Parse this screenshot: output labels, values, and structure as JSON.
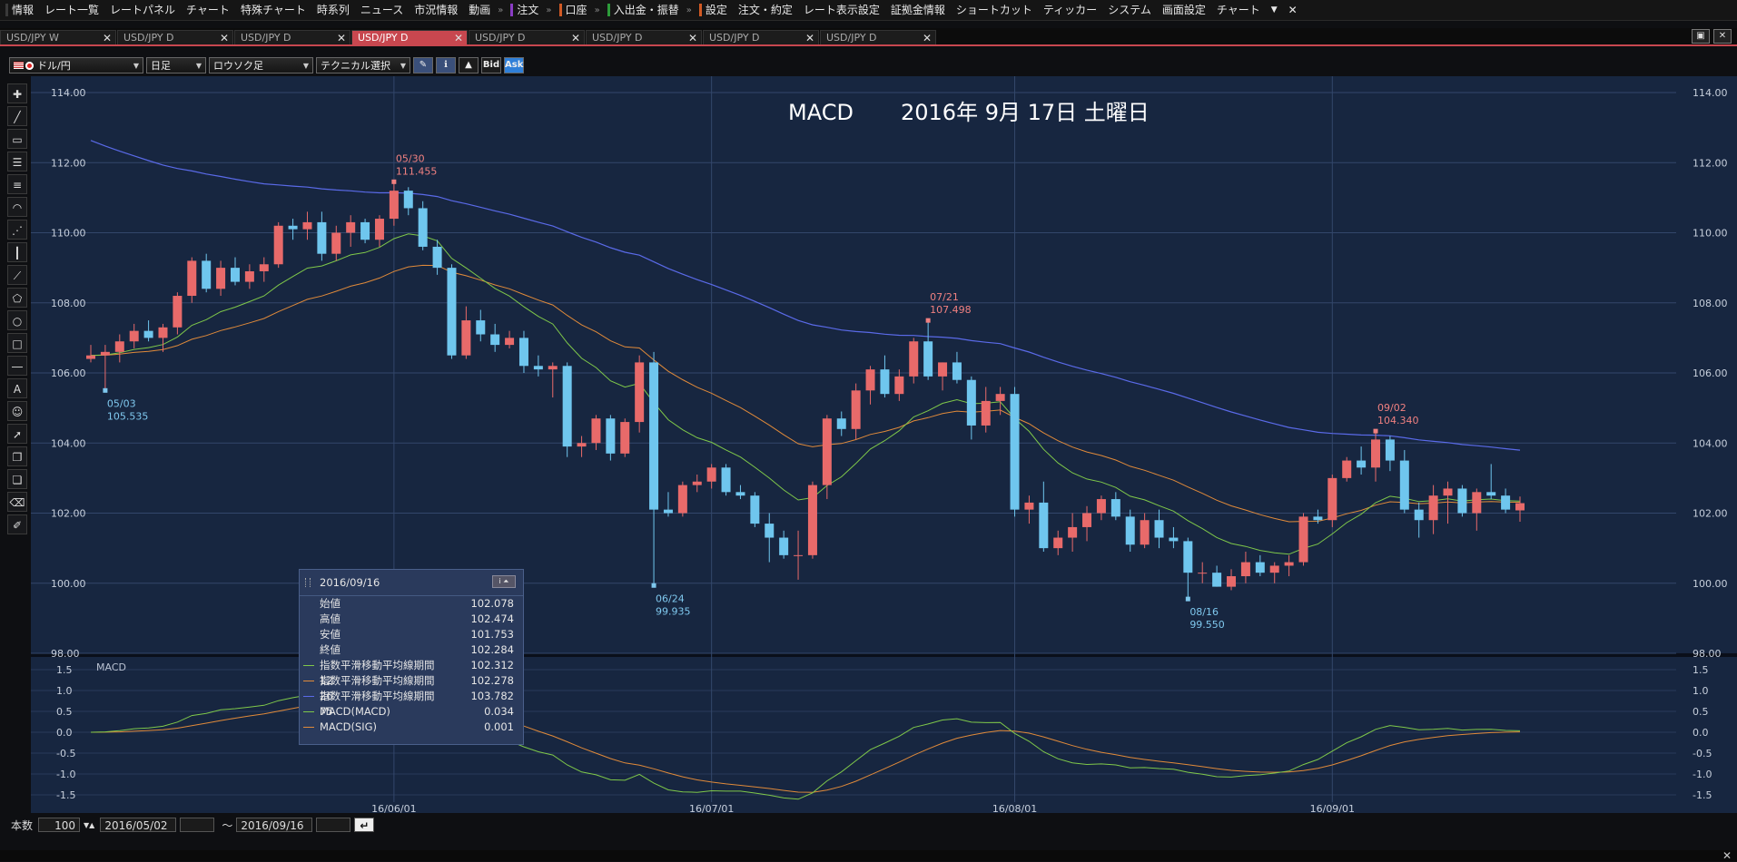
{
  "menubar": {
    "items": [
      {
        "label": "情報",
        "mark": "#3a3a3a"
      },
      {
        "label": "レート一覧"
      },
      {
        "label": "レートパネル"
      },
      {
        "label": "チャート"
      },
      {
        "label": "特殊チャート"
      },
      {
        "label": "時系列"
      },
      {
        "label": "ニュース"
      },
      {
        "label": "市況情報"
      },
      {
        "label": "動画"
      },
      {
        "label": "注文",
        "mark": "#8a3cc4"
      },
      {
        "label": "口座",
        "mark": "#d25a24"
      },
      {
        "label": "入出金・振替",
        "mark": "#2d9b3a"
      },
      {
        "label": "設定",
        "mark": "#d25a24"
      },
      {
        "label": "注文・約定"
      },
      {
        "label": "レート表示設定"
      },
      {
        "label": "証拠金情報"
      },
      {
        "label": "ショートカット"
      },
      {
        "label": "ティッカー"
      },
      {
        "label": "システム"
      },
      {
        "label": "画面設定"
      },
      {
        "label": "チャート"
      }
    ],
    "more": "▼",
    "close": "✕"
  },
  "tabs": [
    {
      "label": "USD/JPY W",
      "active": false
    },
    {
      "label": "USD/JPY D",
      "active": false
    },
    {
      "label": "USD/JPY D",
      "active": false
    },
    {
      "label": "USD/JPY D",
      "active": true
    },
    {
      "label": "USD/JPY D",
      "active": false
    },
    {
      "label": "USD/JPY D",
      "active": false
    },
    {
      "label": "USD/JPY D",
      "active": false
    },
    {
      "label": "USD/JPY D",
      "active": false
    }
  ],
  "toolbar": {
    "pair": "ドル/円",
    "period": "日足",
    "chart_type": "ロウソク足",
    "technical": "テクニカル選択",
    "bid": "Bid",
    "ask": "Ask"
  },
  "chart": {
    "title": "MACD",
    "date": "2016年 9月 17日 土曜日",
    "y_ticks": [
      "114.00",
      "112.00",
      "110.00",
      "108.00",
      "106.00",
      "104.00",
      "102.00",
      "100.00",
      "98.00"
    ],
    "macd_label": "MACD",
    "macd_ticks": [
      "1.5",
      "1.0",
      "0.5",
      "0.0",
      "-0.5",
      "-1.0",
      "-1.5"
    ],
    "x_ticks": [
      "16/06/01",
      "16/07/01",
      "16/08/01",
      "16/09/01"
    ],
    "annotations": [
      {
        "date": "05/03",
        "price": "105.535",
        "kind": "low"
      },
      {
        "date": "05/30",
        "price": "111.455",
        "kind": "high"
      },
      {
        "date": "06/24",
        "price": "99.935",
        "kind": "low"
      },
      {
        "date": "07/21",
        "price": "107.498",
        "kind": "high"
      },
      {
        "date": "08/16",
        "price": "99.550",
        "kind": "low"
      },
      {
        "date": "09/02",
        "price": "104.340",
        "kind": "high"
      }
    ],
    "colors": {
      "bg": "#172640",
      "up": "#e86a6a",
      "down": "#6fc6ee",
      "ema12": "#7fc84a",
      "ema26": "#e08a3a",
      "ema75": "#5a6ae8",
      "grid": "#33476b"
    }
  },
  "datawindow": {
    "date": "2016/09/16",
    "rows": [
      {
        "label": "始値",
        "value": "102.078"
      },
      {
        "label": "高値",
        "value": "102.474"
      },
      {
        "label": "安値",
        "value": "101.753"
      },
      {
        "label": "終値",
        "value": "102.284"
      },
      {
        "label": "指数平滑移動平均線期間12",
        "value": "102.312",
        "color": "#7fc84a"
      },
      {
        "label": "指数平滑移動平均線期間26",
        "value": "102.278",
        "color": "#e08a3a"
      },
      {
        "label": "指数平滑移動平均線期間75",
        "value": "103.782",
        "color": "#5a6ae8"
      },
      {
        "label": "MACD(MACD)",
        "value": "0.034",
        "color": "#7fc84a"
      },
      {
        "label": "MACD(SIG)",
        "value": "0.001",
        "color": "#e08a3a"
      }
    ]
  },
  "bottombar": {
    "count_label": "本数",
    "count": "100",
    "from": "2016/05/02",
    "tilde": "～",
    "to": "2016/09/16"
  },
  "chart_data": {
    "type": "candlestick",
    "candles": [
      [
        106.4,
        106.8,
        106.3,
        106.5
      ],
      [
        106.5,
        106.8,
        105.5,
        106.6
      ],
      [
        106.6,
        107.1,
        106.3,
        106.9
      ],
      [
        106.9,
        107.4,
        106.7,
        107.2
      ],
      [
        107.2,
        107.5,
        106.9,
        107.0
      ],
      [
        107.0,
        107.4,
        106.6,
        107.3
      ],
      [
        107.3,
        108.3,
        107.1,
        108.2
      ],
      [
        108.2,
        109.3,
        108.0,
        109.2
      ],
      [
        109.2,
        109.4,
        108.3,
        108.4
      ],
      [
        108.4,
        109.2,
        108.2,
        109.0
      ],
      [
        109.0,
        109.3,
        108.5,
        108.6
      ],
      [
        108.6,
        109.1,
        108.4,
        108.9
      ],
      [
        108.9,
        109.3,
        108.6,
        109.1
      ],
      [
        109.1,
        110.3,
        109.0,
        110.2
      ],
      [
        110.2,
        110.4,
        109.8,
        110.1
      ],
      [
        110.1,
        110.6,
        109.8,
        110.3
      ],
      [
        110.3,
        110.6,
        109.2,
        109.4
      ],
      [
        109.4,
        110.2,
        109.2,
        110.0
      ],
      [
        110.0,
        110.5,
        109.6,
        110.3
      ],
      [
        110.3,
        110.4,
        109.7,
        109.8
      ],
      [
        109.8,
        110.5,
        109.6,
        110.4
      ],
      [
        110.4,
        111.455,
        110.2,
        111.2
      ],
      [
        111.2,
        111.3,
        110.5,
        110.7
      ],
      [
        110.7,
        110.9,
        109.5,
        109.6
      ],
      [
        109.6,
        109.8,
        108.8,
        109.0
      ],
      [
        109.0,
        109.1,
        106.4,
        106.5
      ],
      [
        106.5,
        107.9,
        106.4,
        107.5
      ],
      [
        107.5,
        107.8,
        106.9,
        107.1
      ],
      [
        107.1,
        107.4,
        106.6,
        106.8
      ],
      [
        106.8,
        107.2,
        106.7,
        107.0
      ],
      [
        107.0,
        107.2,
        106.0,
        106.2
      ],
      [
        106.2,
        106.5,
        105.9,
        106.1
      ],
      [
        106.1,
        106.3,
        105.3,
        106.2
      ],
      [
        106.2,
        106.3,
        103.6,
        103.9
      ],
      [
        103.9,
        104.2,
        103.6,
        104.0
      ],
      [
        104.0,
        104.8,
        103.8,
        104.7
      ],
      [
        104.7,
        104.8,
        103.5,
        103.7
      ],
      [
        103.7,
        104.7,
        103.6,
        104.6
      ],
      [
        104.6,
        106.5,
        104.3,
        106.3
      ],
      [
        106.3,
        106.6,
        99.935,
        102.1
      ],
      [
        102.1,
        102.6,
        101.9,
        102.0
      ],
      [
        102.0,
        102.9,
        101.9,
        102.8
      ],
      [
        102.8,
        103.1,
        102.6,
        102.9
      ],
      [
        102.9,
        103.4,
        102.7,
        103.3
      ],
      [
        103.3,
        103.4,
        102.5,
        102.6
      ],
      [
        102.6,
        102.8,
        102.4,
        102.5
      ],
      [
        102.5,
        102.6,
        101.6,
        101.7
      ],
      [
        101.7,
        102.0,
        100.6,
        101.3
      ],
      [
        101.3,
        101.5,
        100.7,
        100.8
      ],
      [
        100.8,
        101.5,
        100.1,
        100.8
      ],
      [
        100.8,
        102.9,
        100.7,
        102.8
      ],
      [
        102.8,
        104.8,
        102.4,
        104.7
      ],
      [
        104.7,
        104.9,
        104.2,
        104.4
      ],
      [
        104.4,
        105.7,
        104.1,
        105.5
      ],
      [
        105.5,
        106.2,
        105.1,
        106.1
      ],
      [
        106.1,
        106.5,
        105.3,
        105.4
      ],
      [
        105.4,
        106.1,
        105.2,
        105.9
      ],
      [
        105.9,
        107.0,
        105.7,
        106.9
      ],
      [
        106.9,
        107.498,
        105.8,
        105.9
      ],
      [
        105.9,
        106.3,
        105.5,
        106.3
      ],
      [
        106.3,
        106.6,
        105.7,
        105.8
      ],
      [
        105.8,
        105.9,
        104.1,
        104.5
      ],
      [
        104.5,
        105.6,
        104.3,
        105.2
      ],
      [
        105.2,
        105.6,
        104.8,
        105.4
      ],
      [
        105.4,
        105.6,
        101.9,
        102.1
      ],
      [
        102.1,
        102.5,
        101.7,
        102.3
      ],
      [
        102.3,
        102.9,
        100.9,
        101.0
      ],
      [
        101.0,
        101.5,
        100.8,
        101.3
      ],
      [
        101.3,
        102.0,
        100.9,
        101.6
      ],
      [
        101.6,
        102.2,
        101.2,
        102.0
      ],
      [
        102.0,
        102.5,
        101.8,
        102.4
      ],
      [
        102.4,
        102.6,
        101.8,
        101.9
      ],
      [
        101.9,
        102.1,
        100.9,
        101.1
      ],
      [
        101.1,
        102.0,
        101.0,
        101.8
      ],
      [
        101.8,
        102.1,
        101.0,
        101.3
      ],
      [
        101.3,
        101.6,
        101.0,
        101.2
      ],
      [
        101.2,
        101.3,
        99.55,
        100.3
      ],
      [
        100.3,
        100.6,
        100.0,
        100.3
      ],
      [
        100.3,
        100.5,
        99.9,
        99.9
      ],
      [
        99.9,
        100.4,
        99.8,
        100.2
      ],
      [
        100.2,
        100.9,
        100.0,
        100.6
      ],
      [
        100.6,
        100.8,
        100.2,
        100.3
      ],
      [
        100.3,
        100.6,
        100.0,
        100.5
      ],
      [
        100.5,
        100.8,
        100.2,
        100.6
      ],
      [
        100.6,
        102.0,
        100.5,
        101.9
      ],
      [
        101.9,
        102.1,
        101.7,
        101.8
      ],
      [
        101.8,
        103.1,
        101.6,
        103.0
      ],
      [
        103.0,
        103.6,
        102.9,
        103.5
      ],
      [
        103.5,
        103.9,
        103.1,
        103.3
      ],
      [
        103.3,
        104.34,
        102.9,
        104.1
      ],
      [
        104.1,
        104.2,
        103.2,
        103.5
      ],
      [
        103.5,
        103.8,
        102.0,
        102.1
      ],
      [
        102.1,
        102.3,
        101.3,
        101.8
      ],
      [
        101.8,
        102.8,
        101.4,
        102.5
      ],
      [
        102.5,
        102.9,
        101.7,
        102.7
      ],
      [
        102.7,
        102.8,
        101.9,
        102.0
      ],
      [
        102.0,
        102.7,
        101.5,
        102.6
      ],
      [
        102.6,
        103.4,
        102.4,
        102.5
      ],
      [
        102.5,
        102.7,
        102.0,
        102.1
      ],
      [
        102.078,
        102.474,
        101.753,
        102.284
      ]
    ],
    "ema12_last": 102.312,
    "ema26_last": 102.278,
    "ema75_last": 103.782,
    "macd_last": 0.034,
    "signal_last": 0.001,
    "ylim": [
      98,
      114
    ],
    "macd_ylim": [
      -1.5,
      1.5
    ]
  }
}
